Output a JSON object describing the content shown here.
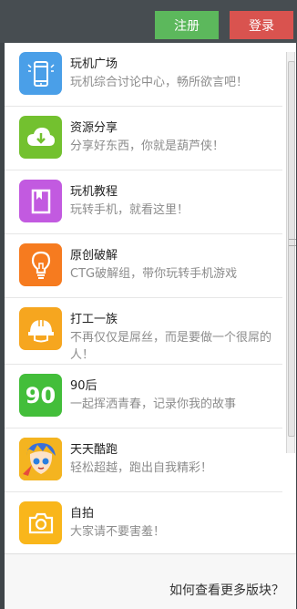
{
  "header": {
    "register_label": "注册",
    "login_label": "登录"
  },
  "colors": {
    "register": "#5cb85c",
    "login": "#d9534f"
  },
  "boards": [
    {
      "title": "玩机广场",
      "desc": "玩机综合讨论中心，畅所欲言吧！",
      "icon": "phone-icon",
      "color": "#4a9fe8"
    },
    {
      "title": "资源分享",
      "desc": "分享好东西，你就是葫芦侠！",
      "icon": "cloud-download-icon",
      "color": "#73c12f"
    },
    {
      "title": "玩机教程",
      "desc": "玩转手机，就看这里！",
      "icon": "book-icon",
      "color": "#c25ae0"
    },
    {
      "title": "原创破解",
      "desc": "CTG破解组，带你玩转手机游戏",
      "icon": "lightbulb-icon",
      "color": "#f67b1f"
    },
    {
      "title": "打工一族",
      "desc": "不再仅仅是屌丝，而是要做一个很屌的人！",
      "icon": "helmet-icon",
      "color": "#f6a61f"
    },
    {
      "title": "90后",
      "desc": "一起挥洒青春，记录你我的故事",
      "icon": "number-90-icon",
      "badge": "90",
      "color": "#43be3a"
    },
    {
      "title": "天天酷跑",
      "desc": "轻松超越，跑出自我精彩！",
      "icon": "game-avatar-icon",
      "color": "#f4b420"
    },
    {
      "title": "自拍",
      "desc": "大家请不要害羞！",
      "icon": "camera-icon",
      "color": "#f9b61b"
    }
  ],
  "footer": {
    "more_text": "如何查看更多版块？"
  }
}
